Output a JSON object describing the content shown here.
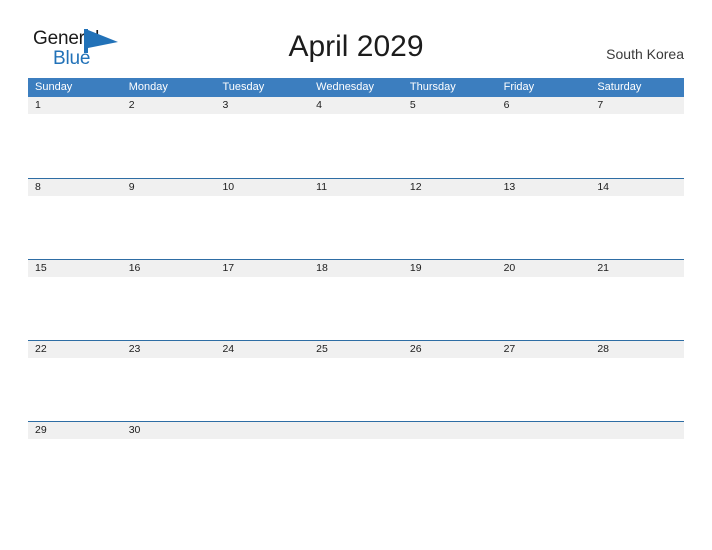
{
  "brand": {
    "name_top": "General",
    "name_bottom": "Blue",
    "mark": "triangle-flag-icon",
    "color_top": "#1a1a1a",
    "color_bottom": "#2272b8",
    "mark_color": "#2272b8"
  },
  "header": {
    "title": "April 2029",
    "region": "South Korea"
  },
  "colors": {
    "header_blue": "#3c7ebf",
    "rule_blue": "#2e6da4",
    "date_band": "#f0f0f0",
    "page_bg": "#ffffff",
    "text": "#1c1c1c"
  },
  "calendar": {
    "month": "April",
    "year": "2029",
    "day_headers": [
      "Sunday",
      "Monday",
      "Tuesday",
      "Wednesday",
      "Thursday",
      "Friday",
      "Saturday"
    ],
    "weeks": [
      {
        "days": [
          "1",
          "2",
          "3",
          "4",
          "5",
          "6",
          "7"
        ]
      },
      {
        "days": [
          "8",
          "9",
          "10",
          "11",
          "12",
          "13",
          "14"
        ]
      },
      {
        "days": [
          "15",
          "16",
          "17",
          "18",
          "19",
          "20",
          "21"
        ]
      },
      {
        "days": [
          "22",
          "23",
          "24",
          "25",
          "26",
          "27",
          "28"
        ]
      },
      {
        "days": [
          "29",
          "30",
          "",
          "",
          "",
          "",
          ""
        ]
      }
    ]
  }
}
